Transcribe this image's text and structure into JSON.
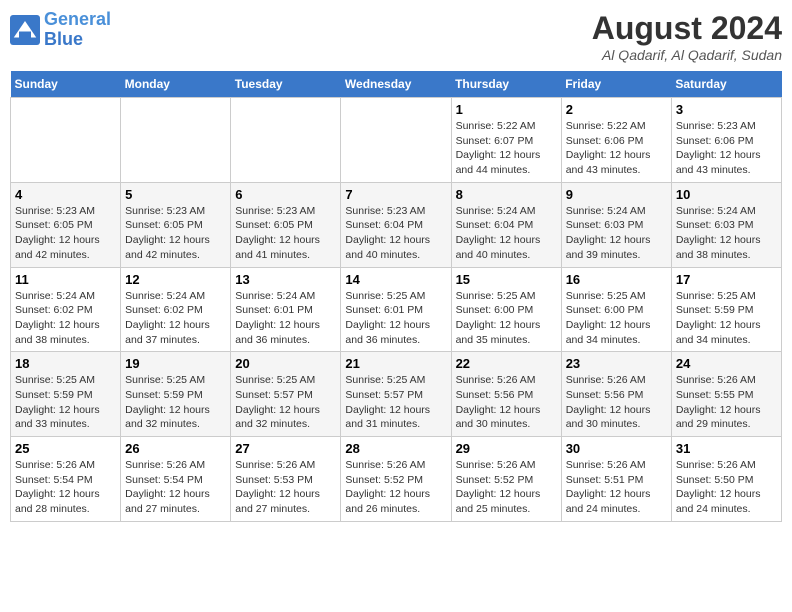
{
  "header": {
    "logo_line1": "General",
    "logo_line2": "Blue",
    "month": "August 2024",
    "location": "Al Qadarif, Al Qadarif, Sudan"
  },
  "days_of_week": [
    "Sunday",
    "Monday",
    "Tuesday",
    "Wednesday",
    "Thursday",
    "Friday",
    "Saturday"
  ],
  "weeks": [
    [
      {
        "day": "",
        "info": ""
      },
      {
        "day": "",
        "info": ""
      },
      {
        "day": "",
        "info": ""
      },
      {
        "day": "",
        "info": ""
      },
      {
        "day": "1",
        "info": "Sunrise: 5:22 AM\nSunset: 6:07 PM\nDaylight: 12 hours\nand 44 minutes."
      },
      {
        "day": "2",
        "info": "Sunrise: 5:22 AM\nSunset: 6:06 PM\nDaylight: 12 hours\nand 43 minutes."
      },
      {
        "day": "3",
        "info": "Sunrise: 5:23 AM\nSunset: 6:06 PM\nDaylight: 12 hours\nand 43 minutes."
      }
    ],
    [
      {
        "day": "4",
        "info": "Sunrise: 5:23 AM\nSunset: 6:05 PM\nDaylight: 12 hours\nand 42 minutes."
      },
      {
        "day": "5",
        "info": "Sunrise: 5:23 AM\nSunset: 6:05 PM\nDaylight: 12 hours\nand 42 minutes."
      },
      {
        "day": "6",
        "info": "Sunrise: 5:23 AM\nSunset: 6:05 PM\nDaylight: 12 hours\nand 41 minutes."
      },
      {
        "day": "7",
        "info": "Sunrise: 5:23 AM\nSunset: 6:04 PM\nDaylight: 12 hours\nand 40 minutes."
      },
      {
        "day": "8",
        "info": "Sunrise: 5:24 AM\nSunset: 6:04 PM\nDaylight: 12 hours\nand 40 minutes."
      },
      {
        "day": "9",
        "info": "Sunrise: 5:24 AM\nSunset: 6:03 PM\nDaylight: 12 hours\nand 39 minutes."
      },
      {
        "day": "10",
        "info": "Sunrise: 5:24 AM\nSunset: 6:03 PM\nDaylight: 12 hours\nand 38 minutes."
      }
    ],
    [
      {
        "day": "11",
        "info": "Sunrise: 5:24 AM\nSunset: 6:02 PM\nDaylight: 12 hours\nand 38 minutes."
      },
      {
        "day": "12",
        "info": "Sunrise: 5:24 AM\nSunset: 6:02 PM\nDaylight: 12 hours\nand 37 minutes."
      },
      {
        "day": "13",
        "info": "Sunrise: 5:24 AM\nSunset: 6:01 PM\nDaylight: 12 hours\nand 36 minutes."
      },
      {
        "day": "14",
        "info": "Sunrise: 5:25 AM\nSunset: 6:01 PM\nDaylight: 12 hours\nand 36 minutes."
      },
      {
        "day": "15",
        "info": "Sunrise: 5:25 AM\nSunset: 6:00 PM\nDaylight: 12 hours\nand 35 minutes."
      },
      {
        "day": "16",
        "info": "Sunrise: 5:25 AM\nSunset: 6:00 PM\nDaylight: 12 hours\nand 34 minutes."
      },
      {
        "day": "17",
        "info": "Sunrise: 5:25 AM\nSunset: 5:59 PM\nDaylight: 12 hours\nand 34 minutes."
      }
    ],
    [
      {
        "day": "18",
        "info": "Sunrise: 5:25 AM\nSunset: 5:59 PM\nDaylight: 12 hours\nand 33 minutes."
      },
      {
        "day": "19",
        "info": "Sunrise: 5:25 AM\nSunset: 5:59 PM\nDaylight: 12 hours\nand 32 minutes."
      },
      {
        "day": "20",
        "info": "Sunrise: 5:25 AM\nSunset: 5:57 PM\nDaylight: 12 hours\nand 32 minutes."
      },
      {
        "day": "21",
        "info": "Sunrise: 5:25 AM\nSunset: 5:57 PM\nDaylight: 12 hours\nand 31 minutes."
      },
      {
        "day": "22",
        "info": "Sunrise: 5:26 AM\nSunset: 5:56 PM\nDaylight: 12 hours\nand 30 minutes."
      },
      {
        "day": "23",
        "info": "Sunrise: 5:26 AM\nSunset: 5:56 PM\nDaylight: 12 hours\nand 30 minutes."
      },
      {
        "day": "24",
        "info": "Sunrise: 5:26 AM\nSunset: 5:55 PM\nDaylight: 12 hours\nand 29 minutes."
      }
    ],
    [
      {
        "day": "25",
        "info": "Sunrise: 5:26 AM\nSunset: 5:54 PM\nDaylight: 12 hours\nand 28 minutes."
      },
      {
        "day": "26",
        "info": "Sunrise: 5:26 AM\nSunset: 5:54 PM\nDaylight: 12 hours\nand 27 minutes."
      },
      {
        "day": "27",
        "info": "Sunrise: 5:26 AM\nSunset: 5:53 PM\nDaylight: 12 hours\nand 27 minutes."
      },
      {
        "day": "28",
        "info": "Sunrise: 5:26 AM\nSunset: 5:52 PM\nDaylight: 12 hours\nand 26 minutes."
      },
      {
        "day": "29",
        "info": "Sunrise: 5:26 AM\nSunset: 5:52 PM\nDaylight: 12 hours\nand 25 minutes."
      },
      {
        "day": "30",
        "info": "Sunrise: 5:26 AM\nSunset: 5:51 PM\nDaylight: 12 hours\nand 24 minutes."
      },
      {
        "day": "31",
        "info": "Sunrise: 5:26 AM\nSunset: 5:50 PM\nDaylight: 12 hours\nand 24 minutes."
      }
    ]
  ]
}
